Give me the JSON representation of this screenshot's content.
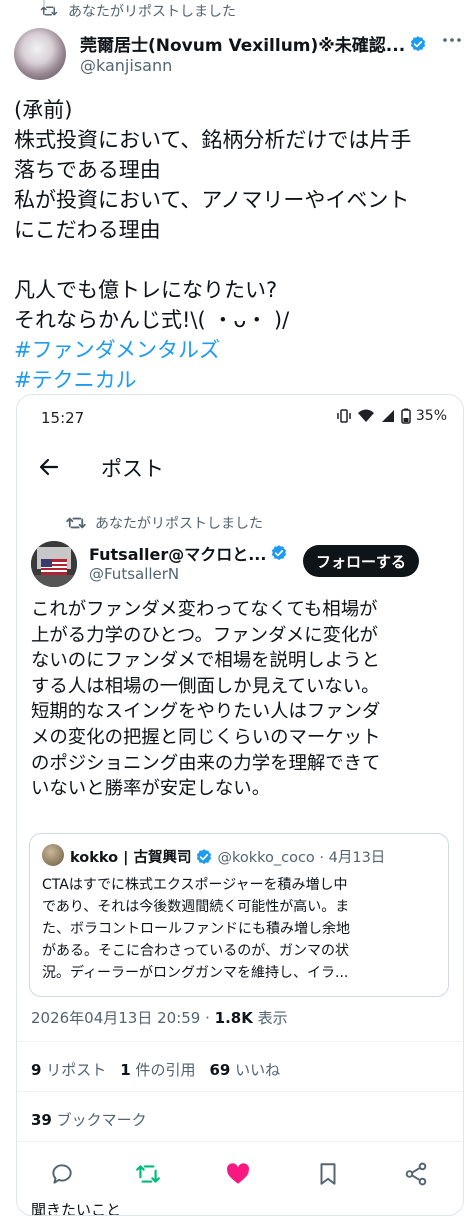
{
  "repost_top": {
    "label": "あなたがリポストしました"
  },
  "author": {
    "name": "莞爾居士(Novum Vexillum)※未確認...",
    "handle": "@kanjisann"
  },
  "post_lines": [
    "(承前)",
    "株式投資において、銘柄分析だけでは片手",
    "落ちである理由",
    "私が投資において、アノマリーやイベント",
    "にこだわる理由",
    "",
    "凡人でも億トレになりたい?",
    "それならかんじ式!\\( ・ᴗ・ )/"
  ],
  "hashtags": [
    "#ファンダメンタルズ",
    "#テクニカル"
  ],
  "phone": {
    "time": "15:27",
    "battery": "35%",
    "title": "ポスト",
    "repost_label": "あなたがリポストしました",
    "author": {
      "name": "Futsaller@マクロと...",
      "handle": "@FutsallerN"
    },
    "follow_label": "フォローする",
    "body_lines": [
      "これがファンダメ変わってなくても相場が",
      "上がる力学のひとつ。ファンダメに変化が",
      "ないのにファンダメで相場を説明しようと",
      "する人は相場の一側面しか見えていない。",
      "短期的なスイングをやりたい人はファンダ",
      "メの変化の把握と同じくらいのマーケット",
      "のポジショニング由来の力学を理解できて",
      "いないと勝率が安定しない。"
    ],
    "quote": {
      "name": "kokko | 古賀興司",
      "handle_date": "@kokko_coco · 4月13日",
      "lines": [
        "CTAはすでに株式エクスポージャーを積み増し中",
        "であり、それは今後数週間続く可能性が高い。ま",
        "た、ボラコントロールファンドにも積み増し余地",
        "がある。そこに合わさっているのが、ガンマの状",
        "況。ディーラーがロングガンマを維持し、イラ..."
      ]
    },
    "timestamp": "2026年04月13日 20:59",
    "views_count": "1.8K",
    "views_label": "表示",
    "stats": [
      {
        "count": "9",
        "label": "リポスト"
      },
      {
        "count": "1",
        "label": "件の引用"
      },
      {
        "count": "69",
        "label": "いいね"
      }
    ],
    "bookmarks": {
      "count": "39",
      "label": "ブックマーク"
    },
    "bottom_text": "聞きたいこと"
  },
  "colors": {
    "accent": "#1d9bf0",
    "retweet": "#00ba7c",
    "like": "#f91880",
    "muted": "#536471"
  },
  "icons": [
    "retweet-icon",
    "verified-icon",
    "more-icon",
    "back-arrow-icon",
    "reply-icon",
    "like-icon",
    "bookmark-icon",
    "share-icon"
  ]
}
